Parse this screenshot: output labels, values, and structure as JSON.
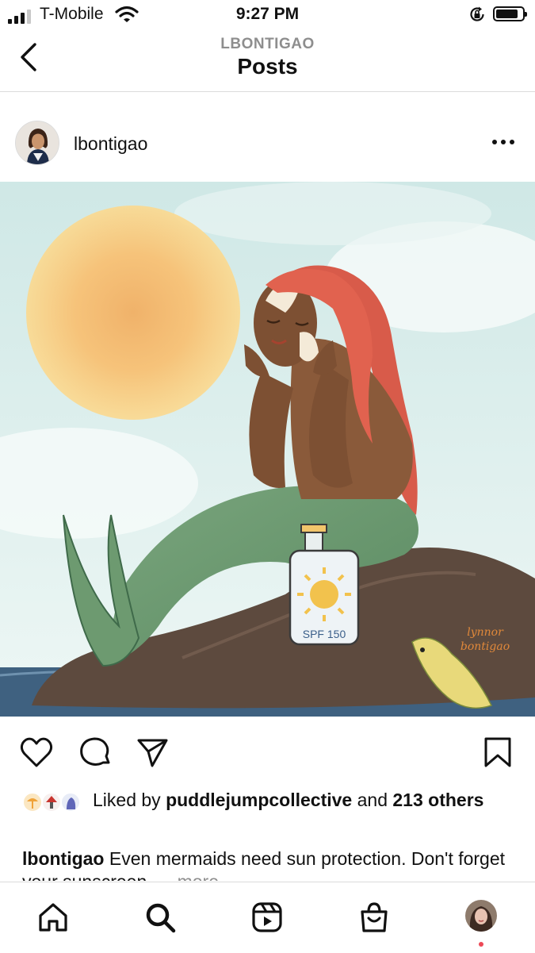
{
  "status": {
    "carrier": "T-Mobile",
    "time": "9:27 PM",
    "battery_level": 0.85,
    "signal_bars": 3,
    "signal_total": 4
  },
  "header": {
    "subtitle": "LBONTIGAO",
    "title": "Posts"
  },
  "post": {
    "username": "lbontigao",
    "image_text": {
      "bottle_label": "SPF 150",
      "signature_line1": "lynnor",
      "signature_line2": "bontigao"
    },
    "likes": {
      "prefix": "Liked by ",
      "user": "puddlejumpcollective",
      "middle": " and ",
      "count": "213",
      "suffix": " others"
    },
    "caption": {
      "username": "lbontigao",
      "text": " Even mermaids need sun protection. Don't forget your sunscreen.",
      "more": "... more"
    }
  },
  "icons": {
    "back": "chevron-left-icon",
    "more": "more-horizontal-icon",
    "like": "heart-icon",
    "comment": "comment-icon",
    "share": "send-icon",
    "save": "bookmark-icon",
    "home": "home-icon",
    "search": "search-icon",
    "reels": "reels-icon",
    "shop": "shop-bag-icon",
    "profile": "profile-avatar"
  },
  "colors": {
    "text": "#111111",
    "muted": "#8e8e8e",
    "divider": "#dbdbdb",
    "notification_dot": "#ed4956"
  }
}
